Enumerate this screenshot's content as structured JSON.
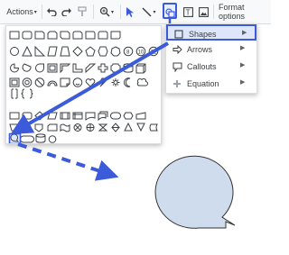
{
  "toolbar": {
    "actions_label": "Actions",
    "format_options_label": "Format options",
    "undo_icon": "undo-icon",
    "redo_icon": "redo-icon",
    "paint_format_icon": "paint-format-icon",
    "zoom_icon": "zoom-icon",
    "select_icon": "select-cursor-icon",
    "line_icon": "line-icon",
    "shapes_icon": "shapes-icon",
    "textbox_icon": "text-box-icon",
    "image_icon": "image-icon"
  },
  "shape_menu": {
    "items": [
      {
        "label": "Shapes",
        "icon": "square-icon",
        "selected": true
      },
      {
        "label": "Arrows",
        "icon": "arrow-right-icon",
        "selected": false
      },
      {
        "label": "Callouts",
        "icon": "callout-icon",
        "selected": false
      },
      {
        "label": "Equation",
        "icon": "plus-icon",
        "selected": false
      }
    ]
  },
  "colors": {
    "accent": "#3b5bdb",
    "shape_fill": "#cfdcee",
    "shape_stroke": "#333333",
    "menu_highlight": "#dde6fb"
  }
}
